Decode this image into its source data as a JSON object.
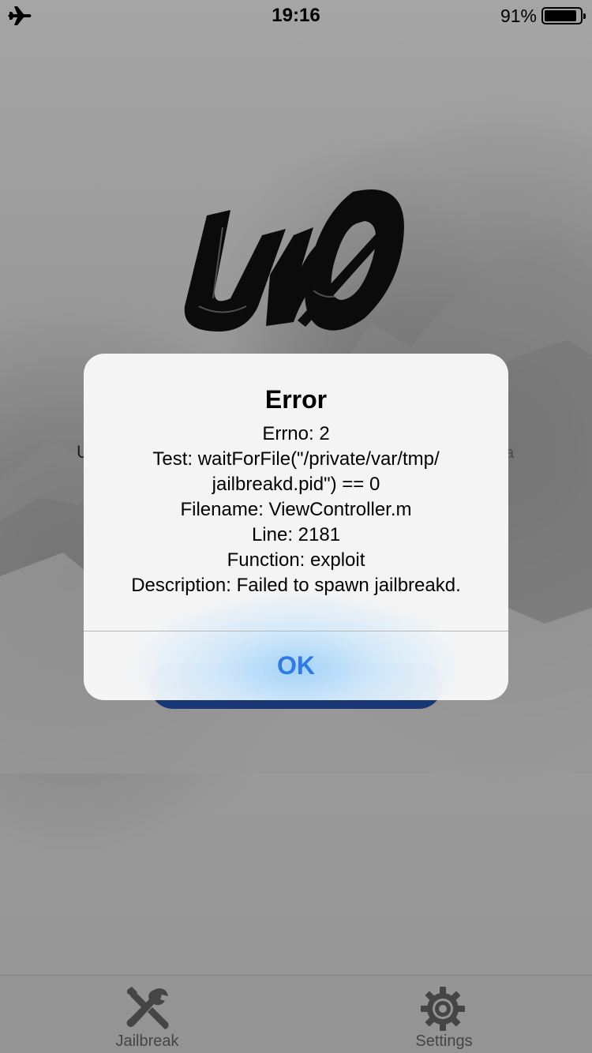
{
  "status_bar": {
    "time": "19:16",
    "battery_percent": "91%",
    "battery_level": 0.91,
    "airplane_icon": "airplane-icon"
  },
  "background": {
    "text_left": "U",
    "text_right": "a"
  },
  "alert": {
    "title": "Error",
    "lines": [
      "Errno: 2",
      "Test: waitForFile(\"/private/var/tmp/",
      "jailbreakd.pid\") == 0",
      "Filename: ViewController.m",
      "Line: 2181",
      "Function: exploit",
      "Description: Failed to spawn jailbreakd."
    ],
    "ok_label": "OK",
    "ok_color": "#2f7ae5"
  },
  "tab_bar": {
    "items": [
      {
        "label": "Jailbreak",
        "icon": "tools-icon"
      },
      {
        "label": "Settings",
        "icon": "gear-icon"
      }
    ]
  },
  "colors": {
    "button_blue": "#1e3f86",
    "tab_gray": "#4f4f4f"
  }
}
